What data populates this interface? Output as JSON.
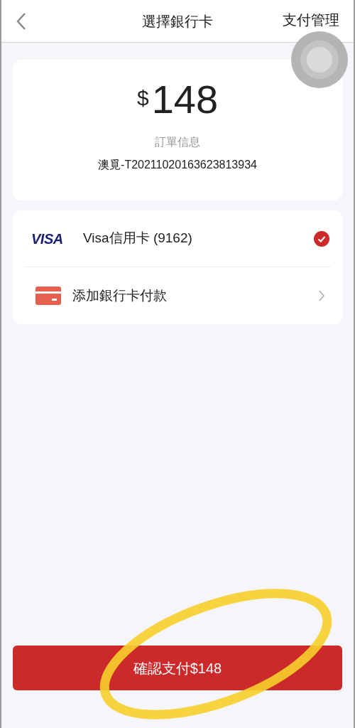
{
  "header": {
    "title": "選擇銀行卡",
    "action": "支付管理"
  },
  "order": {
    "currency": "$",
    "amount": "148",
    "label": "訂單信息",
    "number": "澳覓-T20211020163623813934"
  },
  "payment_methods": [
    {
      "kind": "card",
      "brand": "VISA",
      "label": "Visa信用卡 (9162)",
      "selected": true
    }
  ],
  "add_card": {
    "label": "添加銀行卡付款"
  },
  "confirm_button": {
    "label": "確認支付$148"
  }
}
